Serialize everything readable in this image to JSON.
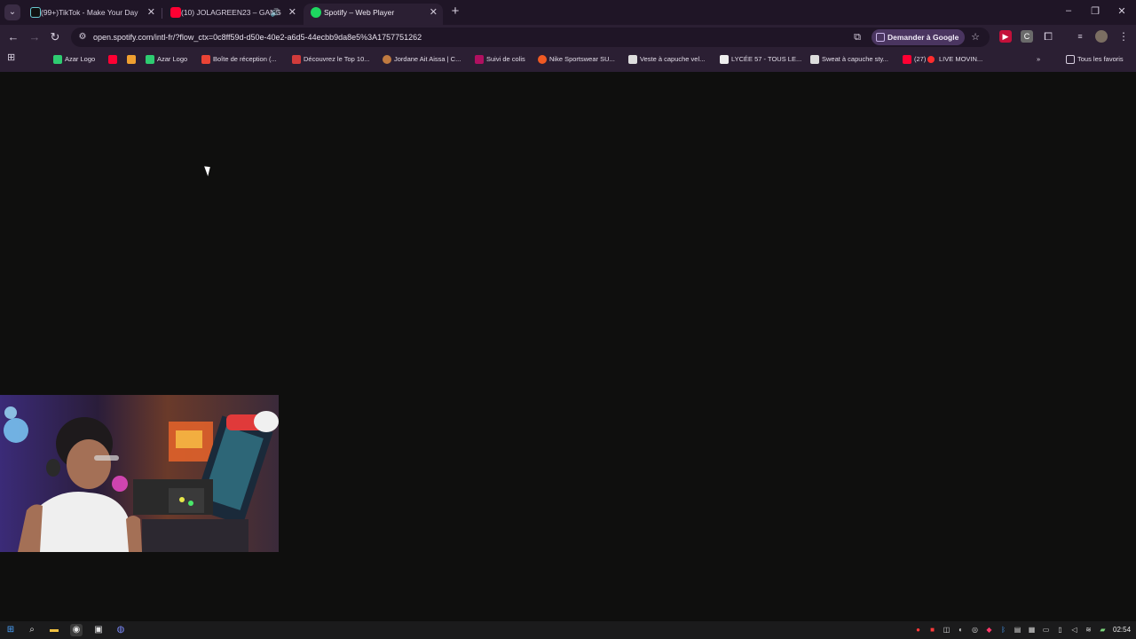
{
  "tabs": [
    {
      "title": "(99+)TikTok - Make Your Day",
      "favicon": "tiktok-icon",
      "active": false
    },
    {
      "title": "(10) JOLAGREEN23 – GANG",
      "favicon": "youtube-icon",
      "active": false,
      "audio": "speaker-icon"
    },
    {
      "title": "Spotify – Web Player",
      "favicon": "spotify-icon",
      "active": true
    }
  ],
  "new_tab_symbol": "+",
  "address_bar": {
    "url": "open.spotify.com/intl-fr/?flow_ctx=0c8ff59d-d50e-40e2-a6d5-44ecbb9da8e5%3A1757751262",
    "ask_google_label": "Demander à Google"
  },
  "bookmarks": [
    {
      "label": "Azar Logo",
      "icon": "azar-icon",
      "color": "#2ecc71"
    },
    {
      "label": "",
      "icon": "youtube-icon",
      "color": "#ff0033"
    },
    {
      "label": "",
      "icon": "notes-icon",
      "color": "#f0a030"
    },
    {
      "label": "Azar Logo",
      "icon": "azar-icon",
      "color": "#2ecc71"
    },
    {
      "label": "Boîte de réception (...",
      "icon": "gmail-icon",
      "color": "#ea4335"
    },
    {
      "label": "Découvrez le Top 10...",
      "icon": "tl-icon",
      "color": "#d13b3b"
    },
    {
      "label": "Jordane Ait Aissa | C...",
      "icon": "person-icon",
      "color": "#c07a40"
    },
    {
      "label": "Suivi de colis",
      "icon": "parcel-icon",
      "color": "#b01060"
    },
    {
      "label": "Nike Sportswear SU...",
      "icon": "nike-icon",
      "color": "#f05a23"
    },
    {
      "label": "Veste à capuche vel...",
      "icon": "page-icon",
      "color": "#dddddd"
    },
    {
      "label": "LYCÉE 57 - TOUS LE...",
      "icon": "y-icon",
      "color": "#eeeeee"
    },
    {
      "label": "Sweat à capuche sty...",
      "icon": "page-icon",
      "color": "#dddddd"
    },
    {
      "label": "(27)",
      "icon": "youtube-icon",
      "color": "#ff0033"
    },
    {
      "label": "LIVE MOVIN...",
      "icon": "live-dot-icon",
      "color": "#ff2d2d"
    }
  ],
  "all_bookmarks_label": "Tous les favoris",
  "clock": "02:54"
}
